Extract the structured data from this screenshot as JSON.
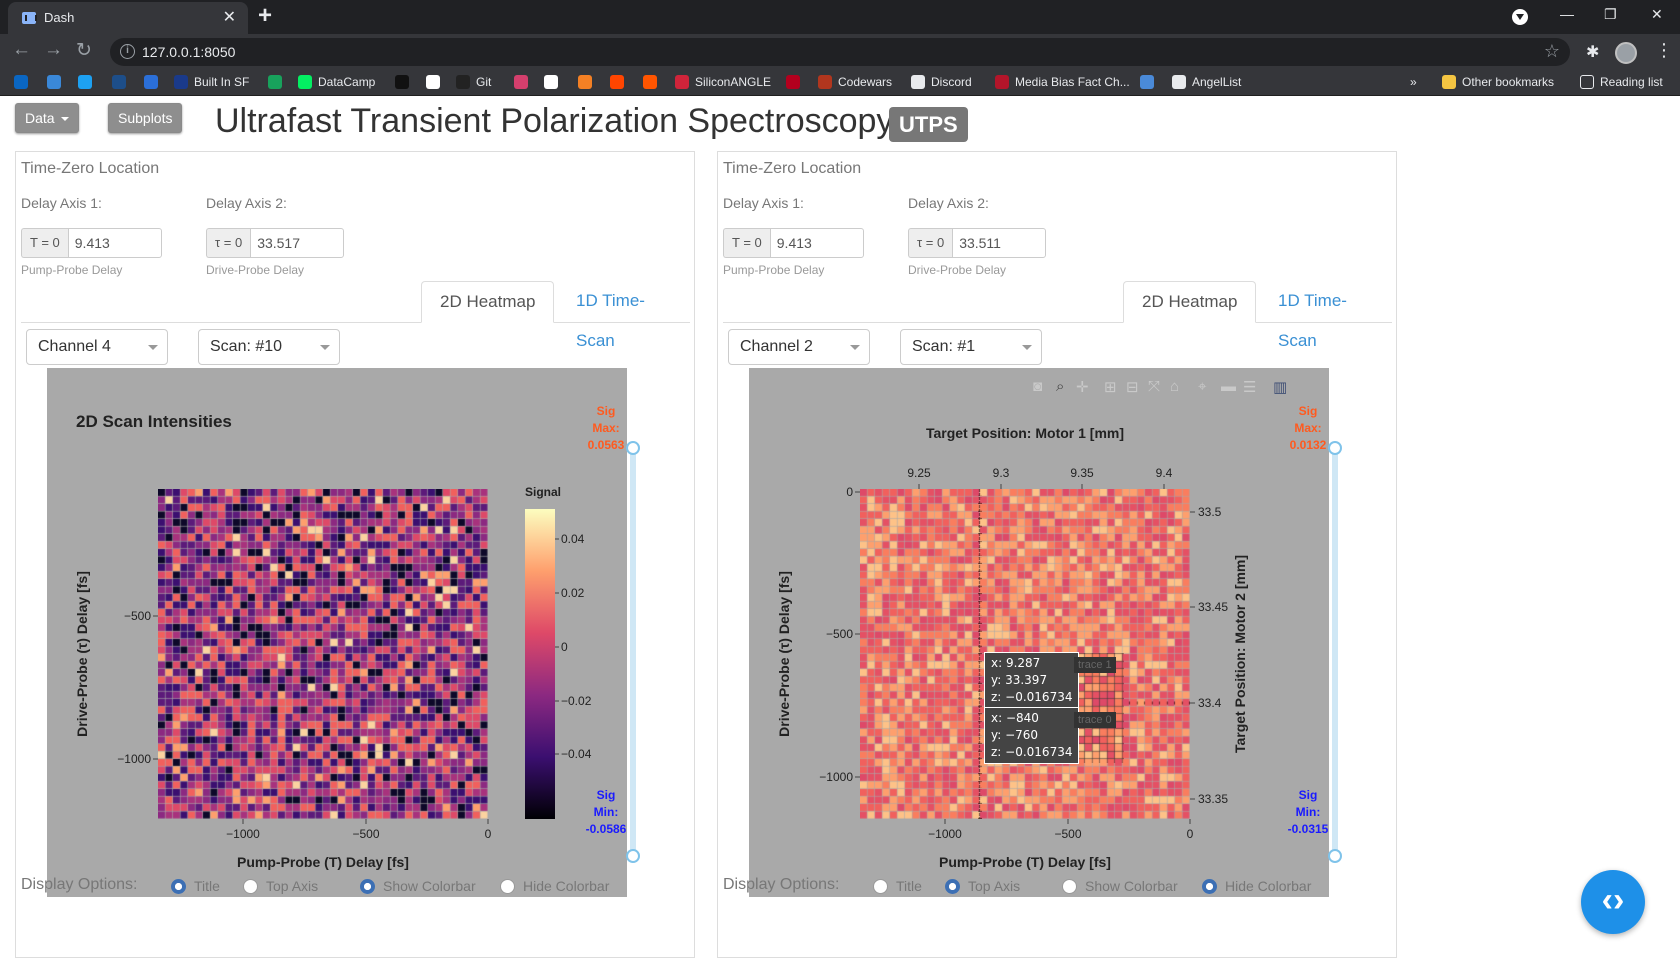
{
  "browser": {
    "tab_title": "Dash",
    "url": "127.0.0.1:8050",
    "bookmarks": [
      {
        "label": "",
        "color": "#0a66c2"
      },
      {
        "label": "",
        "color": "#3a88d8"
      },
      {
        "label": "",
        "color": "#1da1f2"
      },
      {
        "label": "",
        "color": "#1d4e89"
      },
      {
        "label": "",
        "color": "#2b6fd8"
      },
      {
        "label": "Built In SF",
        "color": "#1a3a8a"
      },
      {
        "label": "",
        "color": "#18a25c"
      },
      {
        "label": "DataCamp",
        "color": "#03ef62"
      },
      {
        "label": "",
        "color": "#111111"
      },
      {
        "label": "",
        "color": "#ffffff"
      },
      {
        "label": "Git",
        "color": "#222222"
      },
      {
        "label": "",
        "color": "#d43f6d"
      },
      {
        "label": "",
        "color": "#ffffff"
      },
      {
        "label": "",
        "color": "#f48024"
      },
      {
        "label": "",
        "color": "#ff4500"
      },
      {
        "label": "",
        "color": "#ff5500"
      },
      {
        "label": "SiliconANGLE",
        "color": "#d0243a"
      },
      {
        "label": "",
        "color": "#b3001e"
      },
      {
        "label": "Codewars",
        "color": "#b1361e"
      },
      {
        "label": "Discord",
        "color": "#e8eaed"
      },
      {
        "label": "Media Bias Fact Ch...",
        "color": "#b3152a"
      },
      {
        "label": "",
        "color": "#4a8ad8"
      },
      {
        "label": "AngelList",
        "color": "#e8eaed"
      }
    ],
    "overflow": "»",
    "other_bookmarks": "Other bookmarks",
    "reading_list": "Reading list"
  },
  "header": {
    "data_button": "Data",
    "subplots_button": "Subplots",
    "title": "Ultrafast Transient Polarization Spectroscopy",
    "badge": "UTPS"
  },
  "panels": [
    {
      "section_title": "Time-Zero Location",
      "delay1_label": "Delay Axis 1:",
      "delay2_label": "Delay Axis 2:",
      "t0_addon": "T = 0",
      "t0_value": "9.413",
      "t0_help": "Pump-Probe Delay",
      "tau0_addon": "τ = 0",
      "tau0_value": "33.517",
      "tau0_help": "Drive-Probe Delay",
      "tab_active": "2D Heatmap",
      "tab_other": "1D Time-Scan",
      "channel": "Channel 4",
      "scan": "Scan: #10",
      "plot_title": "2D Scan Intensities",
      "xlabel": "Pump-Probe (T) Delay [fs]",
      "ylabel": "Drive-Probe (τ) Delay [fs]",
      "xticks": [
        "−1000",
        "−500",
        "0"
      ],
      "yticks": [
        "−500",
        "−1000"
      ],
      "colorbar_title": "Signal",
      "colorbar_ticks": [
        "0.04",
        "0.02",
        "0",
        "−0.02",
        "−0.04"
      ],
      "sig_max_label": [
        "Sig",
        "Max:"
      ],
      "sig_max": "0.0563",
      "sig_min_label": [
        "Sig",
        "Min:"
      ],
      "sig_min": "-0.0586",
      "options_title": "Display Options:",
      "options": [
        {
          "label": "Title",
          "checked": true
        },
        {
          "label": "Top Axis",
          "checked": false
        },
        {
          "label": "Show Colorbar",
          "checked": true
        },
        {
          "label": "Hide Colorbar",
          "checked": false
        }
      ]
    },
    {
      "section_title": "Time-Zero Location",
      "delay1_label": "Delay Axis 1:",
      "delay2_label": "Delay Axis 2:",
      "t0_addon": "T = 0",
      "t0_value": "9.413",
      "t0_help": "Pump-Probe Delay",
      "tau0_addon": "τ = 0",
      "tau0_value": "33.511",
      "tau0_help": "Drive-Probe Delay",
      "tab_active": "2D Heatmap",
      "tab_other": "1D Time-Scan",
      "channel": "Channel 2",
      "scan": "Scan: #1",
      "top_axis_title": "Target Position: Motor 1 [mm]",
      "right_axis_title": "Target Position: Motor 2 [mm]",
      "xlabel": "Pump-Probe (T) Delay [fs]",
      "ylabel": "Drive-Probe (τ) Delay [fs]",
      "xticks": [
        "−1000",
        "−500",
        "0"
      ],
      "yticks": [
        "0",
        "−500",
        "−1000"
      ],
      "top_ticks": [
        "9.25",
        "9.3",
        "9.35",
        "9.4"
      ],
      "right_ticks": [
        "33.5",
        "33.45",
        "33.4",
        "33.35"
      ],
      "tooltip1": [
        "x: 9.287",
        "y: 33.397",
        "z: −0.016734"
      ],
      "tooltip2": [
        "x: −840",
        "y: −760",
        "z: −0.016734"
      ],
      "trace1": "trace 1",
      "trace0": "trace 0",
      "sig_max_label": [
        "Sig",
        "Max:"
      ],
      "sig_max": "0.0132",
      "sig_min_label": [
        "Sig",
        "Min:"
      ],
      "sig_min": "-0.0315",
      "options_title": "Display Options:",
      "options": [
        {
          "label": "Title",
          "checked": false
        },
        {
          "label": "Top Axis",
          "checked": true
        },
        {
          "label": "Show Colorbar",
          "checked": false
        },
        {
          "label": "Hide Colorbar",
          "checked": true
        }
      ]
    }
  ],
  "colors": {
    "sig_max": "#ff5a1f",
    "sig_min": "#1a1aff",
    "tab_link": "#3a90d4",
    "plot_bg": "#a9a9a9",
    "fab": "#1e90e8"
  }
}
